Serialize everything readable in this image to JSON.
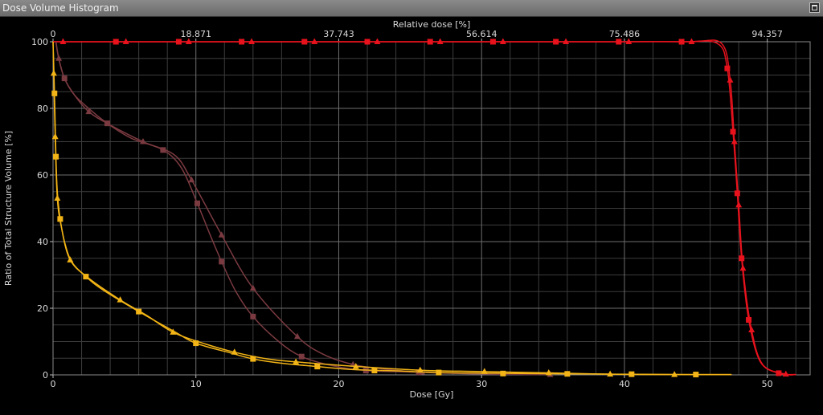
{
  "window": {
    "title": "Dose Volume Histogram"
  },
  "icons": {
    "maximize": "maximize-icon"
  },
  "chart_data": {
    "type": "line",
    "xlabel": "Dose [Gy]",
    "ylabel": "Ratio of Total Structure Volume [%]",
    "x2label": "Relative dose [%]",
    "xlim": [
      0,
      53
    ],
    "ylim": [
      0,
      100
    ],
    "xticks": [
      0,
      10,
      20,
      30,
      40,
      50
    ],
    "yticks": [
      0,
      20,
      40,
      60,
      80,
      100
    ],
    "x2ticks": [
      {
        "dose": 0,
        "label": "0"
      },
      {
        "dose": 10,
        "label": "18.871"
      },
      {
        "dose": 20,
        "label": "37.743"
      },
      {
        "dose": 30,
        "label": "56.614"
      },
      {
        "dose": 40,
        "label": "75.486"
      },
      {
        "dose": 50,
        "label": "94.357"
      }
    ],
    "grid": true,
    "series": [
      {
        "color": "#e8121d",
        "marker": "square",
        "points": [
          [
            0,
            100
          ],
          [
            4.4,
            100
          ],
          [
            8.8,
            100
          ],
          [
            13.2,
            100
          ],
          [
            17.6,
            100
          ],
          [
            22,
            100
          ],
          [
            26.4,
            100
          ],
          [
            30.8,
            100
          ],
          [
            35.2,
            100
          ],
          [
            39.6,
            100
          ],
          [
            44,
            100
          ],
          [
            46.5,
            99.5
          ],
          [
            47.2,
            92
          ],
          [
            47.6,
            73
          ],
          [
            47.9,
            54.5
          ],
          [
            48.2,
            35
          ],
          [
            48.7,
            16.5
          ],
          [
            49.5,
            4
          ],
          [
            50.8,
            0.5
          ],
          [
            52,
            0.1
          ]
        ],
        "markers": [
          [
            4.4,
            100
          ],
          [
            8.8,
            100
          ],
          [
            13.2,
            100
          ],
          [
            17.6,
            100
          ],
          [
            22,
            100
          ],
          [
            26.4,
            100
          ],
          [
            30.8,
            100
          ],
          [
            35.2,
            100
          ],
          [
            39.6,
            100
          ],
          [
            44,
            100
          ],
          [
            47.2,
            92
          ],
          [
            47.6,
            73
          ],
          [
            47.9,
            54.5
          ],
          [
            48.2,
            35
          ],
          [
            48.7,
            16.5
          ],
          [
            50.8,
            0.5
          ]
        ]
      },
      {
        "color": "#e8121d",
        "marker": "triangle",
        "points": [
          [
            0,
            100
          ],
          [
            0.7,
            100
          ],
          [
            5.1,
            100
          ],
          [
            9.5,
            100
          ],
          [
            13.9,
            100
          ],
          [
            18.3,
            100
          ],
          [
            22.7,
            100
          ],
          [
            27.1,
            100
          ],
          [
            31.5,
            100
          ],
          [
            35.9,
            100
          ],
          [
            40.3,
            100
          ],
          [
            44.7,
            100
          ],
          [
            46.8,
            99.5
          ],
          [
            47.4,
            88.5
          ],
          [
            47.7,
            70
          ],
          [
            48,
            51
          ],
          [
            48.3,
            32
          ],
          [
            48.9,
            13.5
          ],
          [
            49.7,
            3
          ],
          [
            51.3,
            0.2
          ],
          [
            52,
            0.1
          ]
        ],
        "markers": [
          [
            0.7,
            100
          ],
          [
            5.1,
            100
          ],
          [
            9.5,
            100
          ],
          [
            13.9,
            100
          ],
          [
            18.3,
            100
          ],
          [
            22.7,
            100
          ],
          [
            27.1,
            100
          ],
          [
            31.5,
            100
          ],
          [
            35.9,
            100
          ],
          [
            40.3,
            100
          ],
          [
            44.7,
            100
          ],
          [
            47.4,
            88.5
          ],
          [
            47.7,
            70
          ],
          [
            48,
            51
          ],
          [
            48.3,
            32
          ],
          [
            48.9,
            13.5
          ],
          [
            51.3,
            0.2
          ]
        ]
      },
      {
        "color": "#7a3a40",
        "marker": "square",
        "points": [
          [
            0.2,
            100
          ],
          [
            0.4,
            95
          ],
          [
            0.8,
            89
          ],
          [
            1.5,
            84
          ],
          [
            2.5,
            80
          ],
          [
            3.8,
            75.5
          ],
          [
            5.5,
            71
          ],
          [
            7.7,
            67.5
          ],
          [
            9,
            62
          ],
          [
            10.1,
            51.5
          ],
          [
            11,
            42
          ],
          [
            11.8,
            34
          ],
          [
            12.8,
            25
          ],
          [
            14,
            17.5
          ],
          [
            15.8,
            10
          ],
          [
            17.4,
            5.5
          ],
          [
            19.5,
            2.8
          ],
          [
            21.9,
            1.3
          ],
          [
            25.6,
            0.8
          ],
          [
            30,
            0.3
          ],
          [
            34,
            0.1
          ]
        ],
        "markers": [
          [
            0.8,
            89
          ],
          [
            3.8,
            75.5
          ],
          [
            7.7,
            67.5
          ],
          [
            10.1,
            51.5
          ],
          [
            11.8,
            34
          ],
          [
            14,
            17.5
          ],
          [
            17.4,
            5.5
          ],
          [
            21.9,
            1.3
          ],
          [
            25.6,
            0.8
          ]
        ]
      },
      {
        "color": "#7a3a40",
        "marker": "triangle",
        "points": [
          [
            0.2,
            100
          ],
          [
            0.4,
            95
          ],
          [
            0.8,
            89
          ],
          [
            1.5,
            84
          ],
          [
            2.5,
            79
          ],
          [
            4,
            75
          ],
          [
            6.3,
            70
          ],
          [
            8.5,
            66
          ],
          [
            9.7,
            58.5
          ],
          [
            11.8,
            42
          ],
          [
            14,
            26
          ],
          [
            17.1,
            11.5
          ],
          [
            19,
            6
          ],
          [
            21,
            3.1
          ],
          [
            23,
            1.8
          ],
          [
            25.8,
            0.8
          ],
          [
            30,
            0.3
          ],
          [
            34.8,
            0.1
          ]
        ],
        "markers": [
          [
            0.4,
            95
          ],
          [
            2.5,
            79
          ],
          [
            6.3,
            70
          ],
          [
            9.7,
            58.5
          ],
          [
            11.8,
            42
          ],
          [
            14,
            26
          ],
          [
            17.1,
            11.5
          ],
          [
            21,
            3.1
          ],
          [
            25.8,
            0.8
          ],
          [
            34.8,
            0.1
          ]
        ]
      },
      {
        "color": "#f2b416",
        "marker": "square",
        "points": [
          [
            0,
            100
          ],
          [
            0.1,
            84.5
          ],
          [
            0.2,
            65.5
          ],
          [
            0.3,
            55
          ],
          [
            0.5,
            46.8
          ],
          [
            0.8,
            40
          ],
          [
            1.3,
            34
          ],
          [
            2.3,
            29.5
          ],
          [
            3.5,
            25.5
          ],
          [
            6,
            19
          ],
          [
            8.5,
            13
          ],
          [
            10,
            9.5
          ],
          [
            12.5,
            6.5
          ],
          [
            14,
            4.8
          ],
          [
            16,
            3.5
          ],
          [
            18.5,
            2.5
          ],
          [
            21,
            1.6
          ],
          [
            24,
            1.2
          ],
          [
            27,
            0.7
          ],
          [
            31,
            0.5
          ],
          [
            36,
            0.3
          ],
          [
            40.5,
            0.2
          ],
          [
            45,
            0.1
          ],
          [
            47.5,
            0.1
          ]
        ],
        "markers": [
          [
            0.1,
            84.5
          ],
          [
            0.2,
            65.5
          ],
          [
            0.5,
            46.8
          ],
          [
            2.3,
            29.5
          ],
          [
            6,
            19
          ],
          [
            10,
            9.5
          ],
          [
            14,
            4.8
          ],
          [
            18.5,
            2.5
          ],
          [
            22.5,
            1.3
          ],
          [
            27,
            0.7
          ],
          [
            31.5,
            0.4
          ],
          [
            36,
            0.3
          ],
          [
            40.5,
            0.2
          ],
          [
            45,
            0.1
          ]
        ]
      },
      {
        "color": "#f2b416",
        "marker": "triangle",
        "points": [
          [
            0,
            100
          ],
          [
            0.05,
            90.5
          ],
          [
            0.15,
            71.5
          ],
          [
            0.3,
            53
          ],
          [
            0.6,
            44
          ],
          [
            1.2,
            34.5
          ],
          [
            2.5,
            29
          ],
          [
            4.7,
            22.5
          ],
          [
            6.5,
            18
          ],
          [
            8.4,
            12.8
          ],
          [
            10.5,
            9.5
          ],
          [
            12.7,
            6.8
          ],
          [
            15,
            4.8
          ],
          [
            17,
            3.9
          ],
          [
            21,
            2.6
          ],
          [
            25.7,
            1.4
          ],
          [
            30,
            1
          ],
          [
            34.7,
            0.6
          ],
          [
            39,
            0.2
          ],
          [
            43.5,
            0.1
          ],
          [
            47.5,
            0.1
          ]
        ],
        "markers": [
          [
            0.05,
            90.5
          ],
          [
            0.15,
            71.5
          ],
          [
            0.3,
            53
          ],
          [
            1.2,
            34.5
          ],
          [
            4.7,
            22.5
          ],
          [
            8.4,
            12.8
          ],
          [
            12.7,
            6.8
          ],
          [
            17,
            3.9
          ],
          [
            21.2,
            2.5
          ],
          [
            25.7,
            1.4
          ],
          [
            30.2,
            1
          ],
          [
            34.7,
            0.6
          ],
          [
            39,
            0.2
          ],
          [
            43.5,
            0.1
          ]
        ]
      }
    ]
  }
}
